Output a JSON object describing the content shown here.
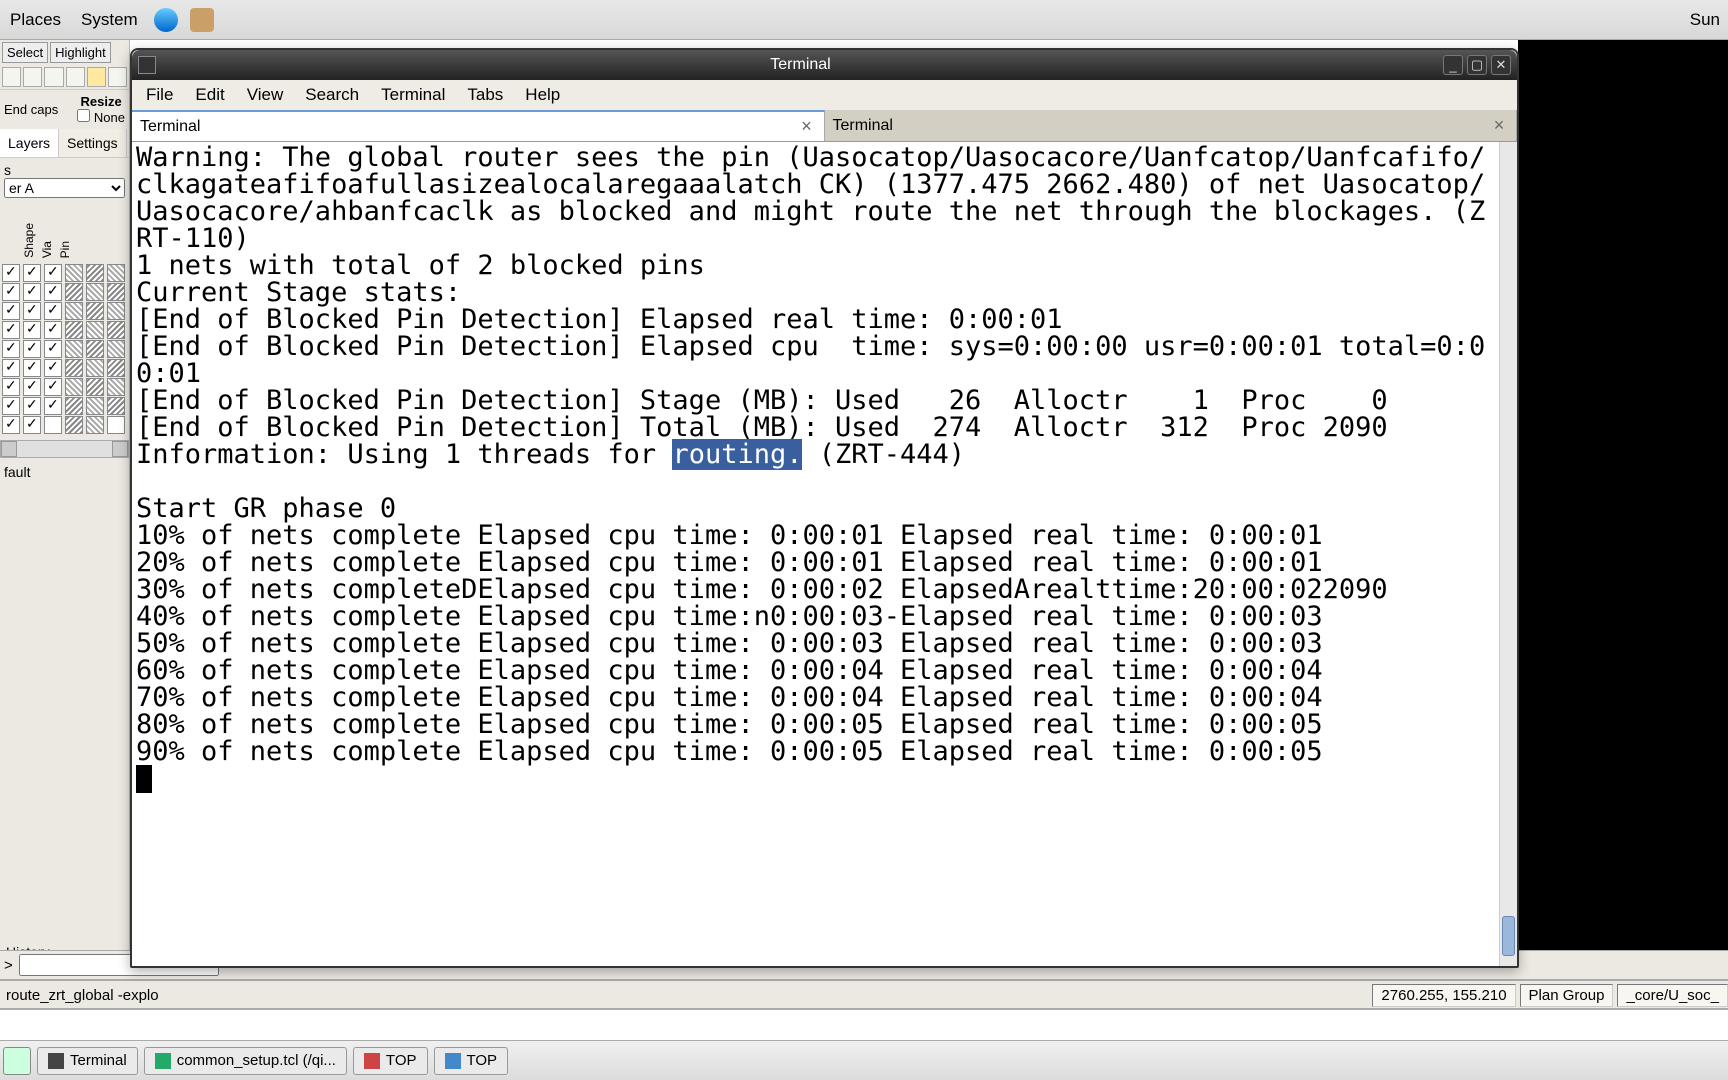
{
  "top_panel": {
    "places": "Places",
    "system": "System",
    "right_text": "Sun"
  },
  "terminal": {
    "title": "Terminal",
    "menu": [
      "File",
      "Edit",
      "View",
      "Search",
      "Terminal",
      "Tabs",
      "Help"
    ],
    "tabs": [
      {
        "label": "Terminal",
        "active": true
      },
      {
        "label": "Terminal",
        "active": false
      }
    ],
    "lines": {
      "warn": "Warning: The global router sees the pin (Uasocatop/Uasocacore/Uanfcatop/Uanfcafifo/clkagateafifoafullasizealocalaregaaalatch CK) (1377.475 2662.480) of net Uasocatop/Uasocacore/ahbanfcaclk as blocked and might route the net through the blockages. (ZRT-110)",
      "l1": "1 nets with total of 2 blocked pins",
      "l2": "Current Stage stats:",
      "l3": "[End of Blocked Pin Detection] Elapsed real time: 0:00:01",
      "l4": "[End of Blocked Pin Detection] Elapsed cpu  time: sys=0:00:00 usr=0:00:01 total=0:00:01",
      "l5": "[End of Blocked Pin Detection] Stage (MB): Used   26  Alloctr    1  Proc    0",
      "l6": "[End of Blocked Pin Detection] Total (MB): Used  274  Alloctr  312  Proc 2090",
      "info_pre": "Information: Using 1 threads for ",
      "info_hl": "routing.",
      "info_post": " (ZRT-444)",
      "blank": "",
      "g0": "Start GR phase 0",
      "p10": "10% of nets complete Elapsed cpu time: 0:00:01 Elapsed real time: 0:00:01",
      "p20": "20% of nets complete Elapsed cpu time: 0:00:01 Elapsed real time: 0:00:01",
      "p30": "30% of nets completeDElapsed cpu time: 0:00:02 ElapsedArealttime:20:00:022090",
      "p40": "40% of nets complete Elapsed cpu time:n0:00:03-Elapsed real time: 0:00:03",
      "p50": "50% of nets complete Elapsed cpu time: 0:00:03 Elapsed real time: 0:00:03",
      "p60": "60% of nets complete Elapsed cpu time: 0:00:04 Elapsed real time: 0:00:04",
      "p70": "70% of nets complete Elapsed cpu time: 0:00:04 Elapsed real time: 0:00:04",
      "p80": "80% of nets complete Elapsed cpu time: 0:00:05 Elapsed real time: 0:00:05",
      "p90": "90% of nets complete Elapsed cpu time: 0:00:05 Elapsed real time: 0:00:05"
    }
  },
  "eda": {
    "select": "Select",
    "highlight": "Highlight",
    "endcaps": "End caps",
    "resize": "Resize",
    "none": "None",
    "tabs_layers": "Layers",
    "tabs_settings": "Settings",
    "dd_label": "s",
    "dd_value": "er A",
    "vheads": [
      "Shape",
      "Via",
      "Pin"
    ],
    "default_lbl": "fault",
    "history_lbl": "History",
    "cmd_prompt": ">",
    "cmd_text": "route_zrt_global -explo",
    "coord": "2760.255, 155.210",
    "plan_group": "Plan Group",
    "plan_val": "_core/U_soc_"
  },
  "taskbar": {
    "items": [
      {
        "label": "Terminal"
      },
      {
        "label": "common_setup.tcl (/qi..."
      },
      {
        "label": "TOP"
      },
      {
        "label": "TOP"
      }
    ]
  }
}
